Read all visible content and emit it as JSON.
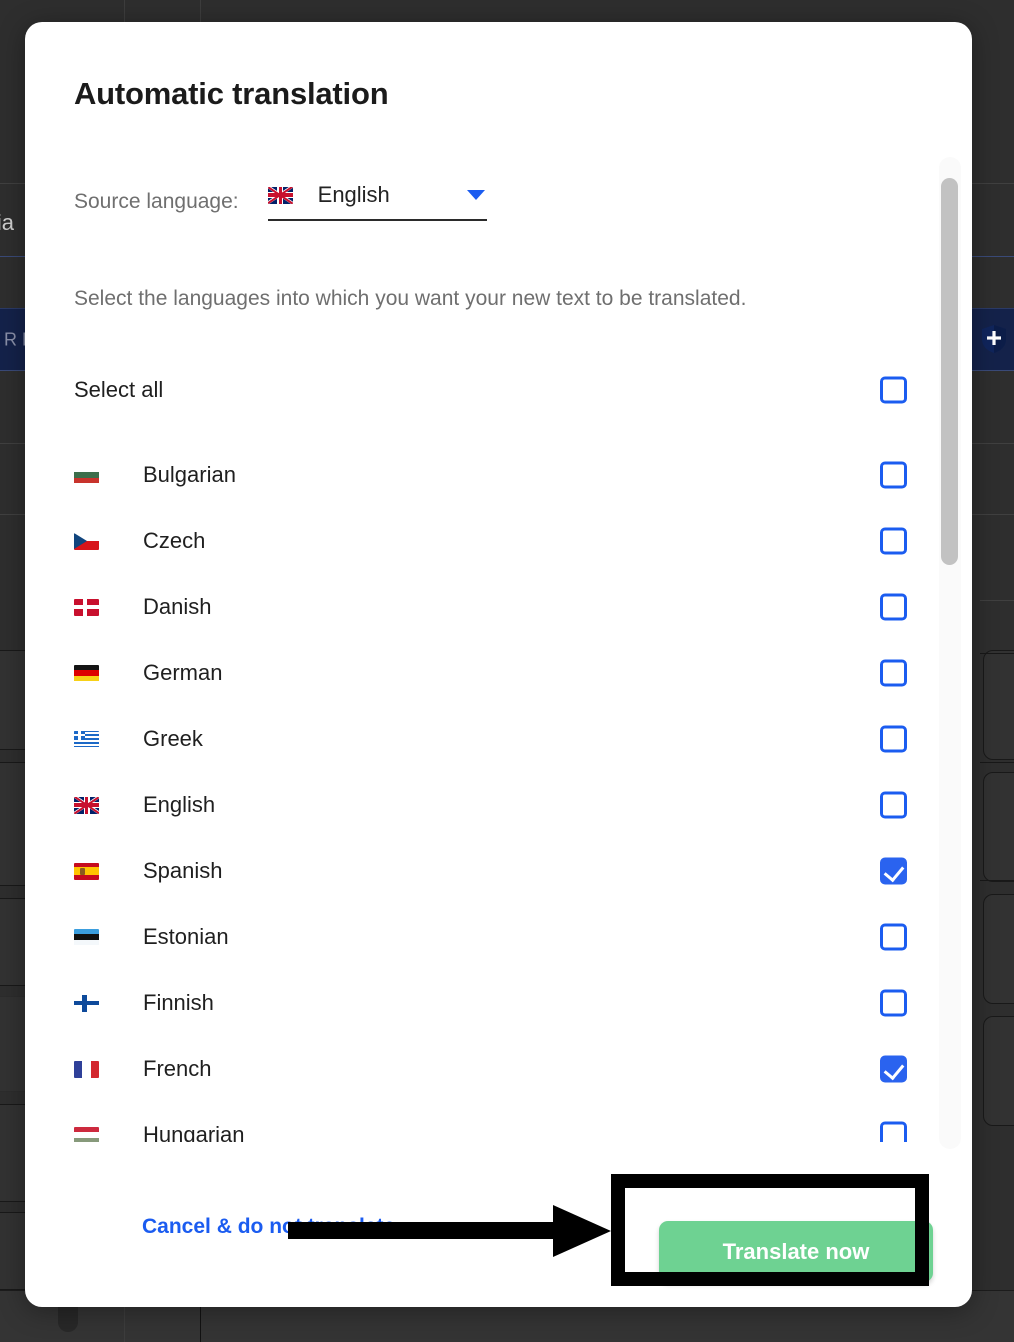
{
  "modal": {
    "title": "Automatic translation",
    "source_label": "Source language:",
    "source_value": "English",
    "source_flag": "flag-gb",
    "description": "Select the languages into which you want your new text to be translated.",
    "select_all_label": "Select all",
    "cancel_label": "Cancel & do not translate",
    "translate_label": "Translate now"
  },
  "languages": [
    {
      "label": "Bulgarian",
      "flag": "flag-bg",
      "checked": false
    },
    {
      "label": "Czech",
      "flag": "flag-cz",
      "checked": false
    },
    {
      "label": "Danish",
      "flag": "flag-dk",
      "checked": false
    },
    {
      "label": "German",
      "flag": "flag-de",
      "checked": false
    },
    {
      "label": "Greek",
      "flag": "flag-gr",
      "checked": false
    },
    {
      "label": "English",
      "flag": "flag-gb",
      "checked": false
    },
    {
      "label": "Spanish",
      "flag": "flag-es",
      "checked": true
    },
    {
      "label": "Estonian",
      "flag": "flag-ee",
      "checked": false
    },
    {
      "label": "Finnish",
      "flag": "flag-fi",
      "checked": false
    },
    {
      "label": "French",
      "flag": "flag-fr",
      "checked": true
    },
    {
      "label": "Hungarian",
      "flag": "flag-hu",
      "checked": false
    }
  ],
  "select_all_checked": false,
  "colors": {
    "accent_blue": "#1b5cf0",
    "checkbox_checked": "#2a63ef",
    "translate_green": "#6ed292",
    "annotation_black": "#000000",
    "overlay_dark": "#2e2e2e",
    "muted_text": "#6f6f6f"
  },
  "background": {
    "partial_text_left": "lia",
    "highlight_band_label": "R D"
  },
  "scrollbar": {
    "thumb_top_pct": 2,
    "thumb_height_pct": 39
  }
}
